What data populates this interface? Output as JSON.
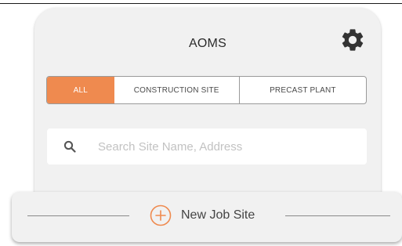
{
  "header": {
    "title": "AOMS",
    "settings_icon": "gear-icon"
  },
  "tabs": [
    {
      "label": "ALL",
      "selected": true
    },
    {
      "label": "CONSTRUCTION SITE",
      "selected": false
    },
    {
      "label": "PRECAST PLANT",
      "selected": false
    }
  ],
  "search": {
    "placeholder": "Search Site Name, Address",
    "value": "",
    "icon": "search-icon"
  },
  "footer": {
    "new_job_label": "New Job Site",
    "new_job_icon": "plus-circle-icon"
  },
  "colors": {
    "accent": "#ef8a4f",
    "card_background": "#f1f1f1",
    "settings_icon": "#333333"
  }
}
